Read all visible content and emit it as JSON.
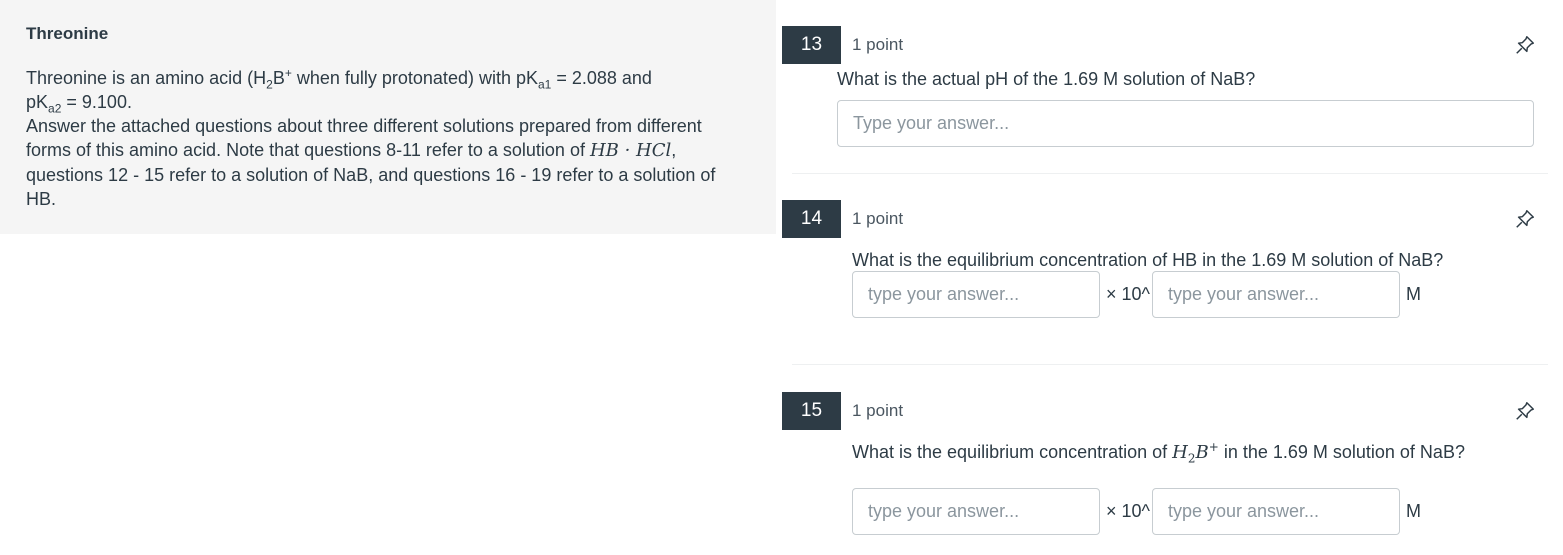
{
  "stimulus": {
    "title": "Threonine",
    "line1_a": "Threonine is an amino acid (H",
    "line1_sub": "2",
    "line1_b": "B",
    "line1_sup": "+",
    "line1_c": " when fully protonated) with pK",
    "line1_sub2": "a1",
    "line1_d": " = 2.088 and",
    "line2_a": "pK",
    "line2_sub": "a2",
    "line2_b": " = 9.100.",
    "para2_a": "Answer the attached questions about three different solutions prepared from different forms of this amino acid. Note that questions 8-11 refer to a solution of ",
    "para2_math": "HB · HCl",
    "para2_b": ", questions 12 - 15 refer to a solution of NaB, and questions 16 - 19 refer to a solution of HB."
  },
  "questions": [
    {
      "number": "13",
      "points": "1 point",
      "text": "What is the actual pH of the 1.69 M solution of NaB?",
      "placeholder": "Type your answer..."
    },
    {
      "number": "14",
      "points": "1 point",
      "text": "What is the equilibrium concentration of HB in the 1.69 M solution of NaB?",
      "mantissa_placeholder": "type your answer...",
      "times_label": "× 10^",
      "exponent_placeholder": "type your answer...",
      "unit": "M"
    },
    {
      "number": "15",
      "points": "1 point",
      "text_a": "What is the equilibrium concentration of ",
      "text_math_base": "H",
      "text_math_sub": "2",
      "text_math_b": "B",
      "text_math_sup": "+",
      "text_b": " in the 1.69 M solution of NaB?",
      "mantissa_placeholder": "type your answer...",
      "times_label": "× 10^",
      "exponent_placeholder": "type your answer...",
      "unit": "M"
    }
  ],
  "icons": {
    "pin": "pin-icon"
  },
  "colors": {
    "badge": "#2d3b45",
    "panel": "#f5f5f5",
    "text": "#2d3b45"
  }
}
